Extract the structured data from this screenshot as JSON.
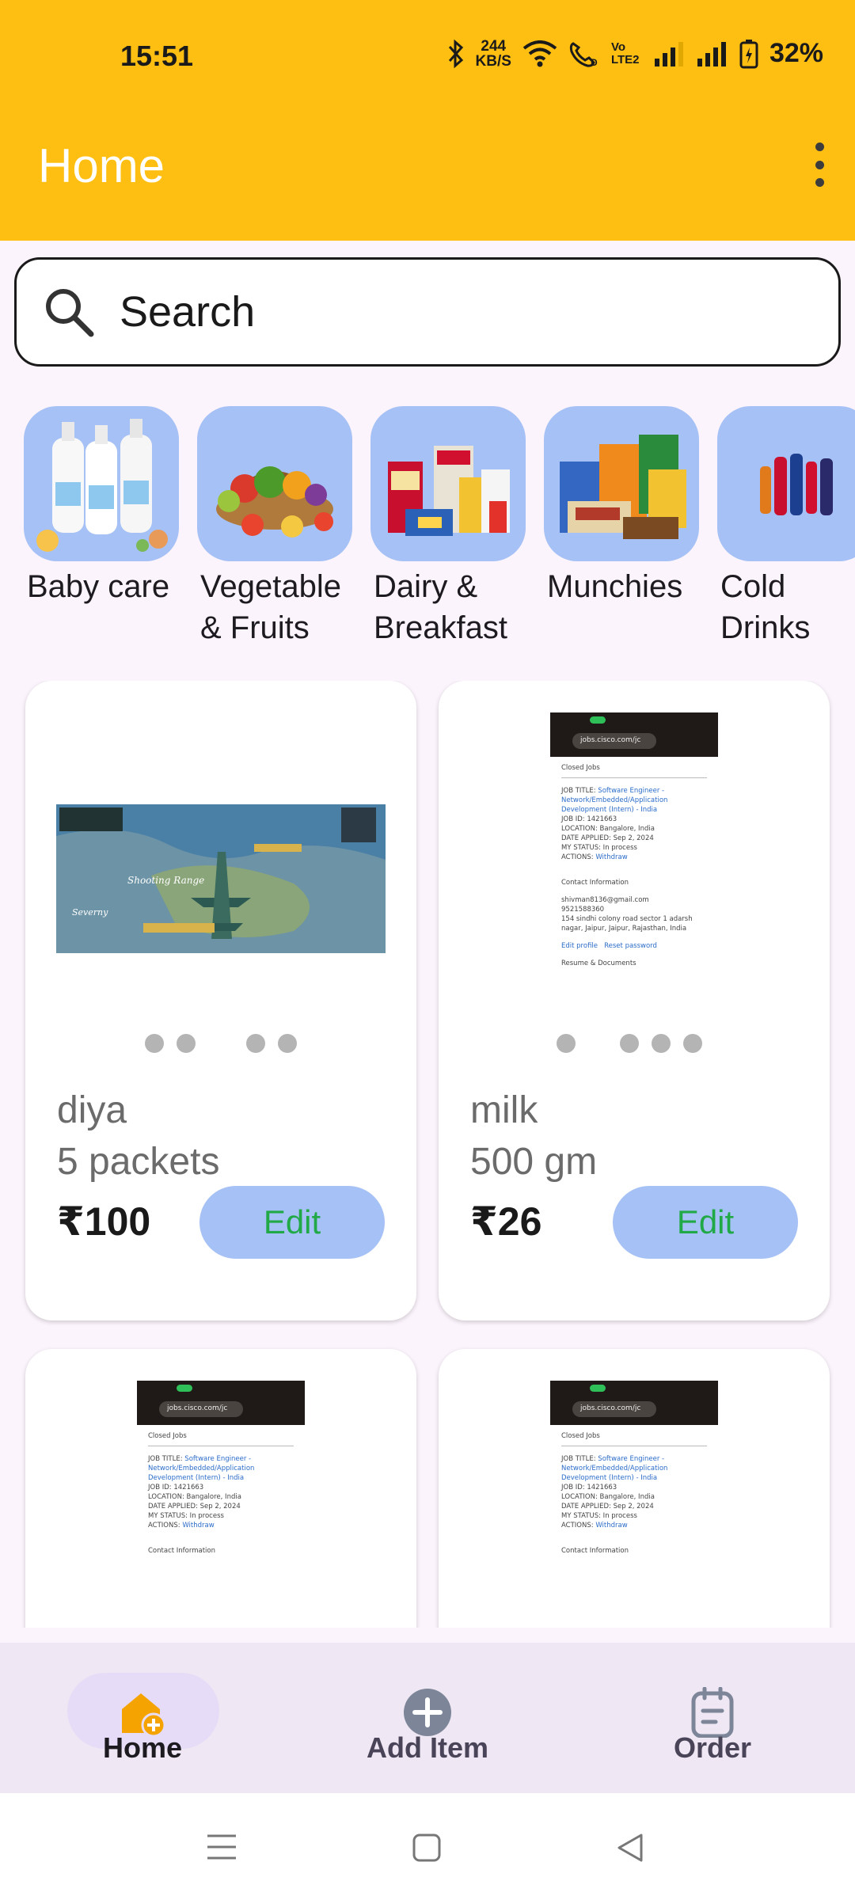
{
  "status_bar": {
    "time": "15:51",
    "net_speed_value": "244",
    "net_speed_unit": "KB/S",
    "volte": "Vo LTE2",
    "battery_percent": "32%",
    "icons": [
      "bluetooth-icon",
      "wifi-icon",
      "wifi-calling-icon",
      "signal-icon",
      "signal-icon",
      "battery-charging-icon"
    ]
  },
  "app_bar": {
    "title": "Home",
    "menu_icon": "more-vert-icon"
  },
  "search": {
    "placeholder": "Search",
    "icon": "search-icon"
  },
  "categories": [
    {
      "label": "Baby care"
    },
    {
      "label": "Vegetable & Fruits"
    },
    {
      "label": "Dairy & Breakfast"
    },
    {
      "label": "Munchies"
    },
    {
      "label": "Cold Drinks"
    }
  ],
  "products": [
    {
      "name": "diya",
      "quantity": "5 packets",
      "price": "₹100",
      "edit_label": "Edit"
    },
    {
      "name": "milk",
      "quantity": "500 gm",
      "price": "₹26",
      "edit_label": "Edit"
    },
    {
      "name": "",
      "quantity": "",
      "price": "",
      "edit_label": ""
    },
    {
      "name": "",
      "quantity": "",
      "price": "",
      "edit_label": ""
    }
  ],
  "bottom_nav": {
    "items": [
      {
        "label": "Home",
        "icon": "home-add-icon",
        "active": true
      },
      {
        "label": "Add Item",
        "icon": "add-circle-icon",
        "active": false
      },
      {
        "label": "Order",
        "icon": "clipboard-icon",
        "active": false
      }
    ]
  },
  "colors": {
    "app_bar": "#ffbf12",
    "card_bg": "#ffffff",
    "accent_blue": "#a6c1f5",
    "edit_text": "#21a947",
    "nav_pill": "#e6dcf7"
  }
}
